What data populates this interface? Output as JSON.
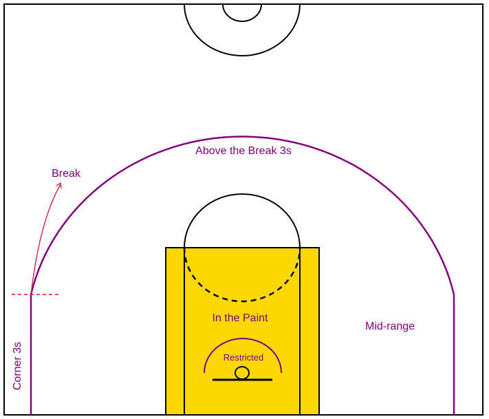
{
  "diagram": {
    "colors": {
      "background": "#ffffff",
      "court_lines": "#000000",
      "paint_fill": "#FFD700",
      "three_point_line": "#800080",
      "label_text": "#800080",
      "break_marker": "#DC143C"
    },
    "labels": {
      "above_break": "Above the Break 3s",
      "break": "Break",
      "corner": "Corner 3s",
      "paint": "In the Paint",
      "mid_range": "Mid-range",
      "restricted": "Restricted"
    }
  }
}
